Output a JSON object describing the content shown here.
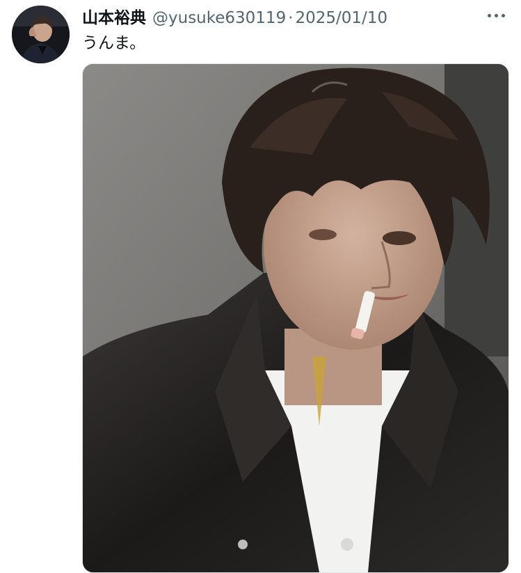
{
  "tweet": {
    "author_name": "山本裕典",
    "handle": "@yusuke630119",
    "separator": "·",
    "date": "2025/01/10",
    "text": "うんま。"
  },
  "icons": {
    "avatar": "profile-photo",
    "more": "more-horizontal-icon",
    "media": "selfie-photo-man-smoking-leather-jacket"
  },
  "colors": {
    "name": "#0f1419",
    "secondary": "#536471",
    "background": "#ffffff"
  }
}
